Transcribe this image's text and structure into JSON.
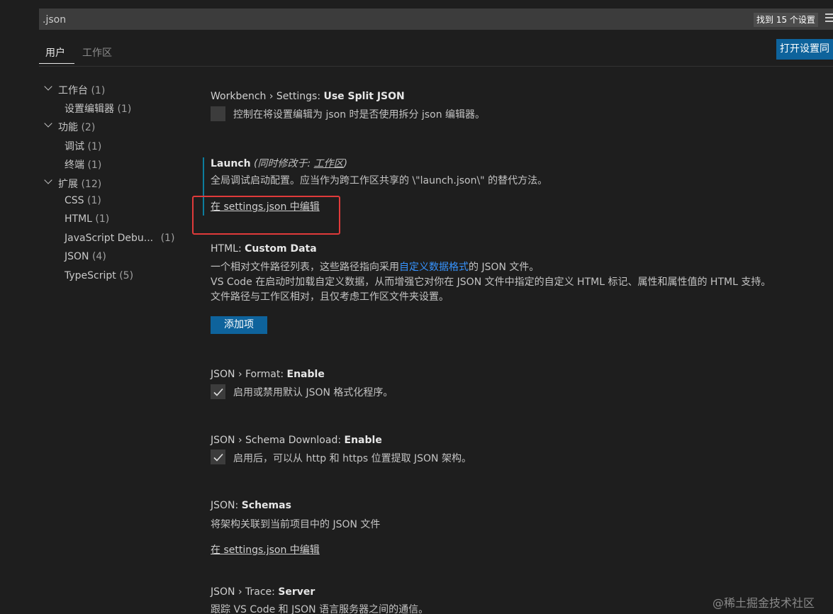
{
  "search": {
    "value": ".json",
    "result_count": "找到 15 个设置"
  },
  "tabs": [
    {
      "label": "用户",
      "active": true
    },
    {
      "label": "工作区",
      "active": false
    }
  ],
  "open_json_button": "打开设置同",
  "toc": [
    {
      "label": "工作台",
      "count": "(1)",
      "expanded": true,
      "level": 0
    },
    {
      "label": "设置编辑器",
      "count": "(1)",
      "level": 1
    },
    {
      "label": "功能",
      "count": "(2)",
      "expanded": true,
      "level": 0
    },
    {
      "label": "调试",
      "count": "(1)",
      "level": 1
    },
    {
      "label": "终端",
      "count": "(1)",
      "level": 1
    },
    {
      "label": "扩展",
      "count": "(12)",
      "expanded": true,
      "level": 0
    },
    {
      "label": "CSS",
      "count": "(1)",
      "level": 1
    },
    {
      "label": "HTML",
      "count": "(1)",
      "level": 1
    },
    {
      "label": "JavaScript Debu...",
      "count": "(1)",
      "level": 1
    },
    {
      "label": "JSON",
      "count": "(4)",
      "level": 1
    },
    {
      "label": "TypeScript",
      "count": "(5)",
      "level": 1
    }
  ],
  "settings": {
    "split_json": {
      "category": "Workbench › Settings: ",
      "name": "Use Split JSON",
      "description": "控制在将设置编辑为 json 时是否使用拆分 json 编辑器。",
      "checked": false
    },
    "launch": {
      "name": "Launch",
      "modified_prefix": " (同时修改于: ",
      "modified_link": "工作区",
      "modified_suffix": ")",
      "description": "全局调试启动配置。应当作为跨工作区共享的 \\\"launch.json\\\" 的替代方法。",
      "edit_link": "在 settings.json 中编辑"
    },
    "html_custom_data": {
      "category": "HTML: ",
      "name": "Custom Data",
      "desc1_pre": "一个相对文件路径列表，这些路径指向采用",
      "desc1_link": "自定义数据格式",
      "desc1_post": "的 JSON 文件。",
      "desc2": "VS Code 在启动时加载自定义数据，从而增强它对你在 JSON 文件中指定的自定义 HTML 标记、属性和属性值的 HTML 支持。",
      "desc3": "文件路径与工作区相对，且仅考虑工作区文件夹设置。",
      "add_button": "添加项"
    },
    "json_format": {
      "category": "JSON › Format: ",
      "name": "Enable",
      "description": "启用或禁用默认 JSON 格式化程序。",
      "checked": true
    },
    "json_schema_download": {
      "category": "JSON › Schema Download: ",
      "name": "Enable",
      "description": "启用后，可以从 http 和 https 位置提取 JSON 架构。",
      "checked": true
    },
    "json_schemas": {
      "category": "JSON: ",
      "name": "Schemas",
      "description": "将架构关联到当前项目中的 JSON 文件",
      "edit_link": "在 settings.json 中编辑"
    },
    "json_trace": {
      "category": "JSON › Trace: ",
      "name": "Server",
      "description": "跟踪 VS Code 和 JSON 语言服务器之间的通信。"
    }
  },
  "watermark": "@稀土掘金技术社区"
}
